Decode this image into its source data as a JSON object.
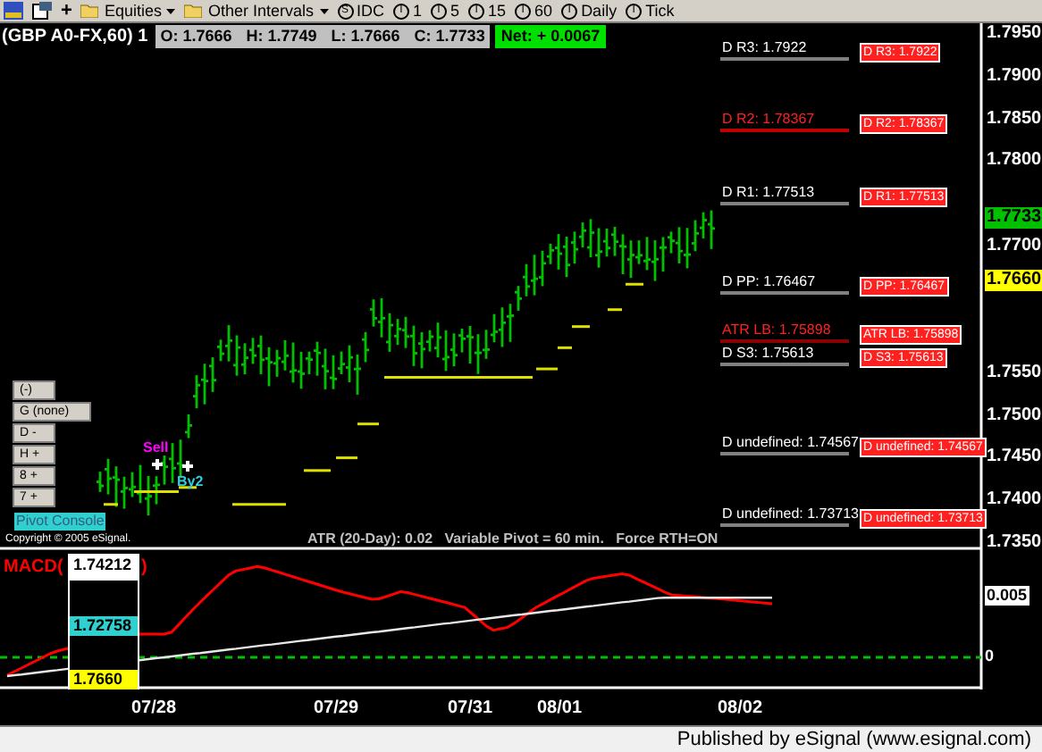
{
  "toolbar": {
    "plus": "+",
    "items": [
      {
        "kind": "menu",
        "label": "Equities"
      },
      {
        "kind": "menu",
        "label": "Other Intervals"
      },
      {
        "kind": "interval",
        "badge": "S",
        "label": "IDC"
      },
      {
        "kind": "interval",
        "badge": "I",
        "label": "1"
      },
      {
        "kind": "interval",
        "badge": "I",
        "label": "5"
      },
      {
        "kind": "interval",
        "badge": "I",
        "label": "15"
      },
      {
        "kind": "interval",
        "badge": "I",
        "label": "60"
      },
      {
        "kind": "interval",
        "badge": "I",
        "label": "Daily"
      },
      {
        "kind": "interval",
        "badge": "I",
        "label": "Tick"
      }
    ]
  },
  "header": {
    "symbol": "(GBP A0-FX,60) 1",
    "quote": [
      "O: 1.7666",
      "H: 1.7749",
      "L: 1.7666",
      "C: 1.7733"
    ],
    "net": "Net: + 0.0067"
  },
  "price_axis": [
    {
      "label": "1.7950",
      "kind": "tick"
    },
    {
      "label": "1.7900",
      "kind": "tick"
    },
    {
      "label": "1.7850",
      "kind": "tick"
    },
    {
      "label": "1.7800",
      "kind": "tick"
    },
    {
      "label": "1.7733",
      "kind": "last"
    },
    {
      "label": "1.7700",
      "kind": "tick"
    },
    {
      "label": "1.7660",
      "kind": "marker"
    },
    {
      "label": "1.7550",
      "kind": "tick"
    },
    {
      "label": "1.7500",
      "kind": "tick"
    },
    {
      "label": "1.7450",
      "kind": "tick"
    },
    {
      "label": "1.7400",
      "kind": "tick"
    },
    {
      "label": "1.7350",
      "kind": "tick"
    }
  ],
  "pivots": [
    {
      "label": "D R3: 1.7922",
      "tag": "D R3: 1.7922",
      "color": "#808080"
    },
    {
      "label": "D R2: 1.78367",
      "tag": "D R2: 1.78367",
      "color": "#c00000"
    },
    {
      "label": "D R1: 1.77513",
      "tag": "D R1: 1.77513",
      "color": "#808080"
    },
    {
      "label": "D PP: 1.76467",
      "tag": "D PP: 1.76467",
      "color": "#808080"
    },
    {
      "label": "ATR LB: 1.75898",
      "tag": "ATR LB: 1.75898",
      "color": "#8b0000"
    },
    {
      "label": "D S3: 1.75613",
      "tag": "D S3: 1.75613",
      "color": "#808080"
    },
    {
      "label": "D undefined: 1.74567",
      "tag": "D undefined: 1.74567",
      "color": "#808080"
    },
    {
      "label": "D undefined: 1.73713",
      "tag": "D undefined: 1.73713",
      "color": "#808080"
    }
  ],
  "controls": [
    "(-)",
    "G (none)",
    "D -",
    "H +",
    "8 +",
    "7 +"
  ],
  "pivot_console": "Pivot Console",
  "copyright": "Copyright © 2005 eSignal.",
  "study_info": "ATR (20-Day): 0.02   Variable Pivot = 60 min.   Force RTH=ON",
  "signals": [
    {
      "label": "Sell",
      "kind": "sell"
    },
    {
      "label": "By2",
      "kind": "buy"
    }
  ],
  "macd": {
    "title": "MACD(",
    "title_end": ")",
    "cursor": [
      {
        "label": "1.74212",
        "kind": "plain"
      },
      {
        "label": "1.72758",
        "kind": "cyan"
      },
      {
        "label": "1.7660",
        "kind": "yellow"
      }
    ],
    "axis": [
      "0.005",
      "0"
    ]
  },
  "dates": [
    "07/28",
    "07/29",
    "07/31",
    "08/01",
    "08/02"
  ],
  "status_bar": "Published by eSignal (www.esignal.com)"
}
